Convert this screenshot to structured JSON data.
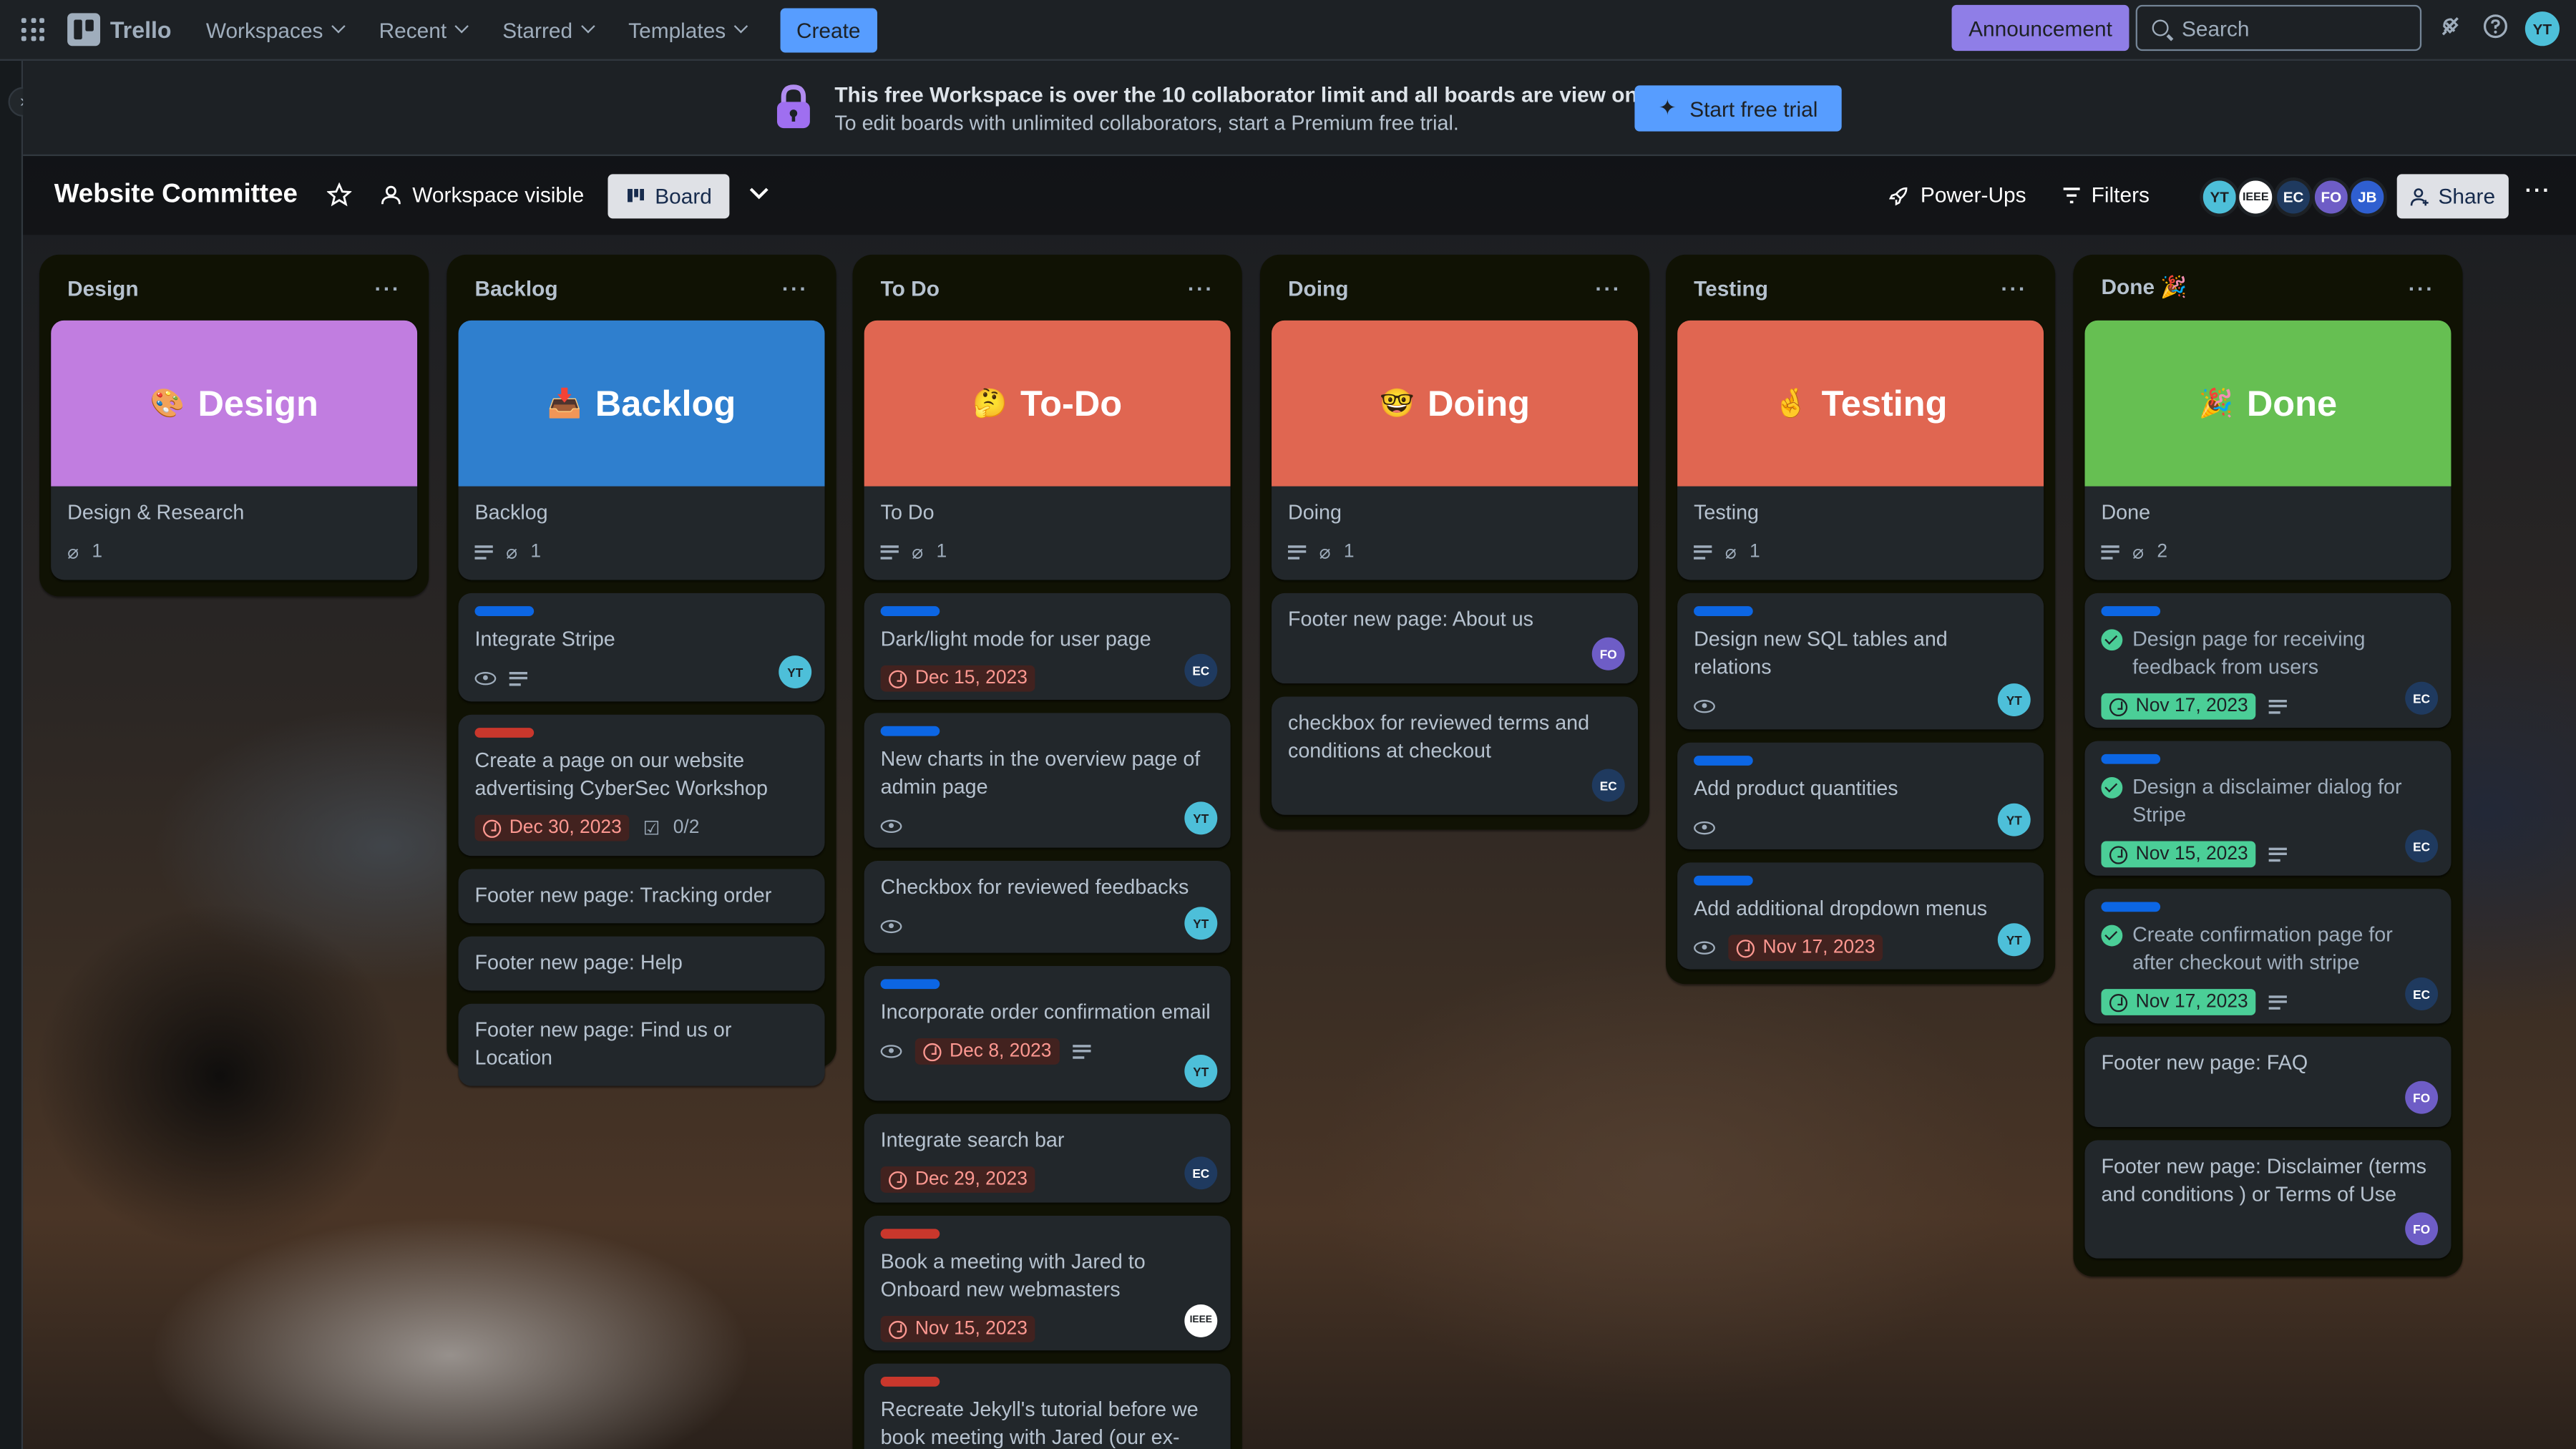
{
  "topbar": {
    "app_name": "Trello",
    "nav": [
      {
        "label": "Workspaces"
      },
      {
        "label": "Recent"
      },
      {
        "label": "Starred"
      },
      {
        "label": "Templates"
      }
    ],
    "create_label": "Create",
    "announcement_label": "Announcement",
    "search_placeholder": "Search",
    "user_initials": "YT"
  },
  "banner": {
    "title": "This free Workspace is over the 10 collaborator limit and all boards are view only.",
    "subtitle": "To edit boards with unlimited collaborators, start a Premium free trial.",
    "button_label": "Start free trial"
  },
  "board": {
    "title": "Website Committee",
    "visibility_label": "Workspace visible",
    "view_label": "Board",
    "powerups_label": "Power-Ups",
    "filters_label": "Filters",
    "share_label": "Share",
    "members": [
      "YT",
      "IEEE",
      "EC",
      "FO",
      "JB"
    ]
  },
  "colors": {
    "accent": "#579dff",
    "announcement": "#8f7ee7",
    "cover_design": "#c17de0",
    "cover_backlog": "#2f7fce",
    "cover_red": "#e06651",
    "cover_done": "#66bf52",
    "label_blue": "#0c66e4",
    "label_red": "#c9372c"
  },
  "lists": {
    "design": {
      "title": "Design",
      "cover_title": "Design",
      "cover_emoji": "🎨",
      "cards": [
        {
          "title": "Design & Research",
          "attachments": "1"
        }
      ]
    },
    "backlog": {
      "title": "Backlog",
      "cover_title": "Backlog",
      "cover_emoji": "📥",
      "cover_card": {
        "title": "Backlog",
        "attachments": "1"
      },
      "cards": [
        {
          "title": "Integrate Stripe",
          "member": "YT"
        },
        {
          "title": "Create a page on our website advertising CyberSec Workshop",
          "due": "Dec 30, 2023",
          "checklist": "0/2"
        },
        {
          "title": "Footer new page: Tracking order"
        },
        {
          "title": "Footer new page: Help"
        },
        {
          "title": "Footer new page: Find us or Location"
        }
      ]
    },
    "todo": {
      "title": "To Do",
      "cover_title": "To-Do",
      "cover_emoji": "🤔",
      "cover_card": {
        "title": "To Do",
        "attachments": "1"
      },
      "cards": [
        {
          "title": "Dark/light mode for user page",
          "due": "Dec 15, 2023",
          "member": "EC"
        },
        {
          "title": "New charts in the overview page of admin page",
          "member": "YT"
        },
        {
          "title": "Checkbox for reviewed feedbacks",
          "member": "YT"
        },
        {
          "title": "Incorporate order confirmation email",
          "due": "Dec 8, 2023",
          "member": "YT"
        },
        {
          "title": "Integrate search bar",
          "due": "Dec 29, 2023",
          "member": "EC"
        },
        {
          "title": "Book a meeting with Jared to Onboard new webmasters",
          "due": "Nov 15, 2023",
          "member": "IEEE"
        },
        {
          "title": "Recreate Jekyll's tutorial before we book meeting with Jared (our ex-"
        }
      ]
    },
    "doing": {
      "title": "Doing",
      "cover_title": "Doing",
      "cover_emoji": "🤓",
      "cover_card": {
        "title": "Doing",
        "attachments": "1"
      },
      "cards": [
        {
          "title": "Footer new page: About us",
          "member": "FO"
        },
        {
          "title": "checkbox for reviewed terms and conditions at checkout",
          "member": "EC"
        }
      ]
    },
    "testing": {
      "title": "Testing",
      "cover_title": "Testing",
      "cover_emoji": "🤞",
      "cover_card": {
        "title": "Testing",
        "attachments": "1"
      },
      "cards": [
        {
          "title": "Design new SQL tables and relations",
          "member": "YT"
        },
        {
          "title": "Add product quantities",
          "member": "YT"
        },
        {
          "title": "Add additional dropdown menus",
          "due": "Nov 17, 2023",
          "member": "YT"
        }
      ]
    },
    "done": {
      "title": "Done 🎉",
      "cover_title": "Done",
      "cover_emoji": "🎉",
      "cover_card": {
        "title": "Done",
        "attachments": "2"
      },
      "cards": [
        {
          "title": "Design page for receiving feedback from users",
          "due": "Nov 17, 2023",
          "member": "EC"
        },
        {
          "title": "Design a disclaimer dialog for Stripe",
          "due": "Nov 15, 2023",
          "member": "EC"
        },
        {
          "title": "Create confirmation page for after checkout with stripe",
          "due": "Nov 17, 2023",
          "member": "EC"
        },
        {
          "title": "Footer new page: FAQ",
          "member": "FO"
        },
        {
          "title": "Footer new page: Disclaimer (terms and conditions ) or Terms of Use",
          "member": "FO"
        }
      ]
    }
  }
}
